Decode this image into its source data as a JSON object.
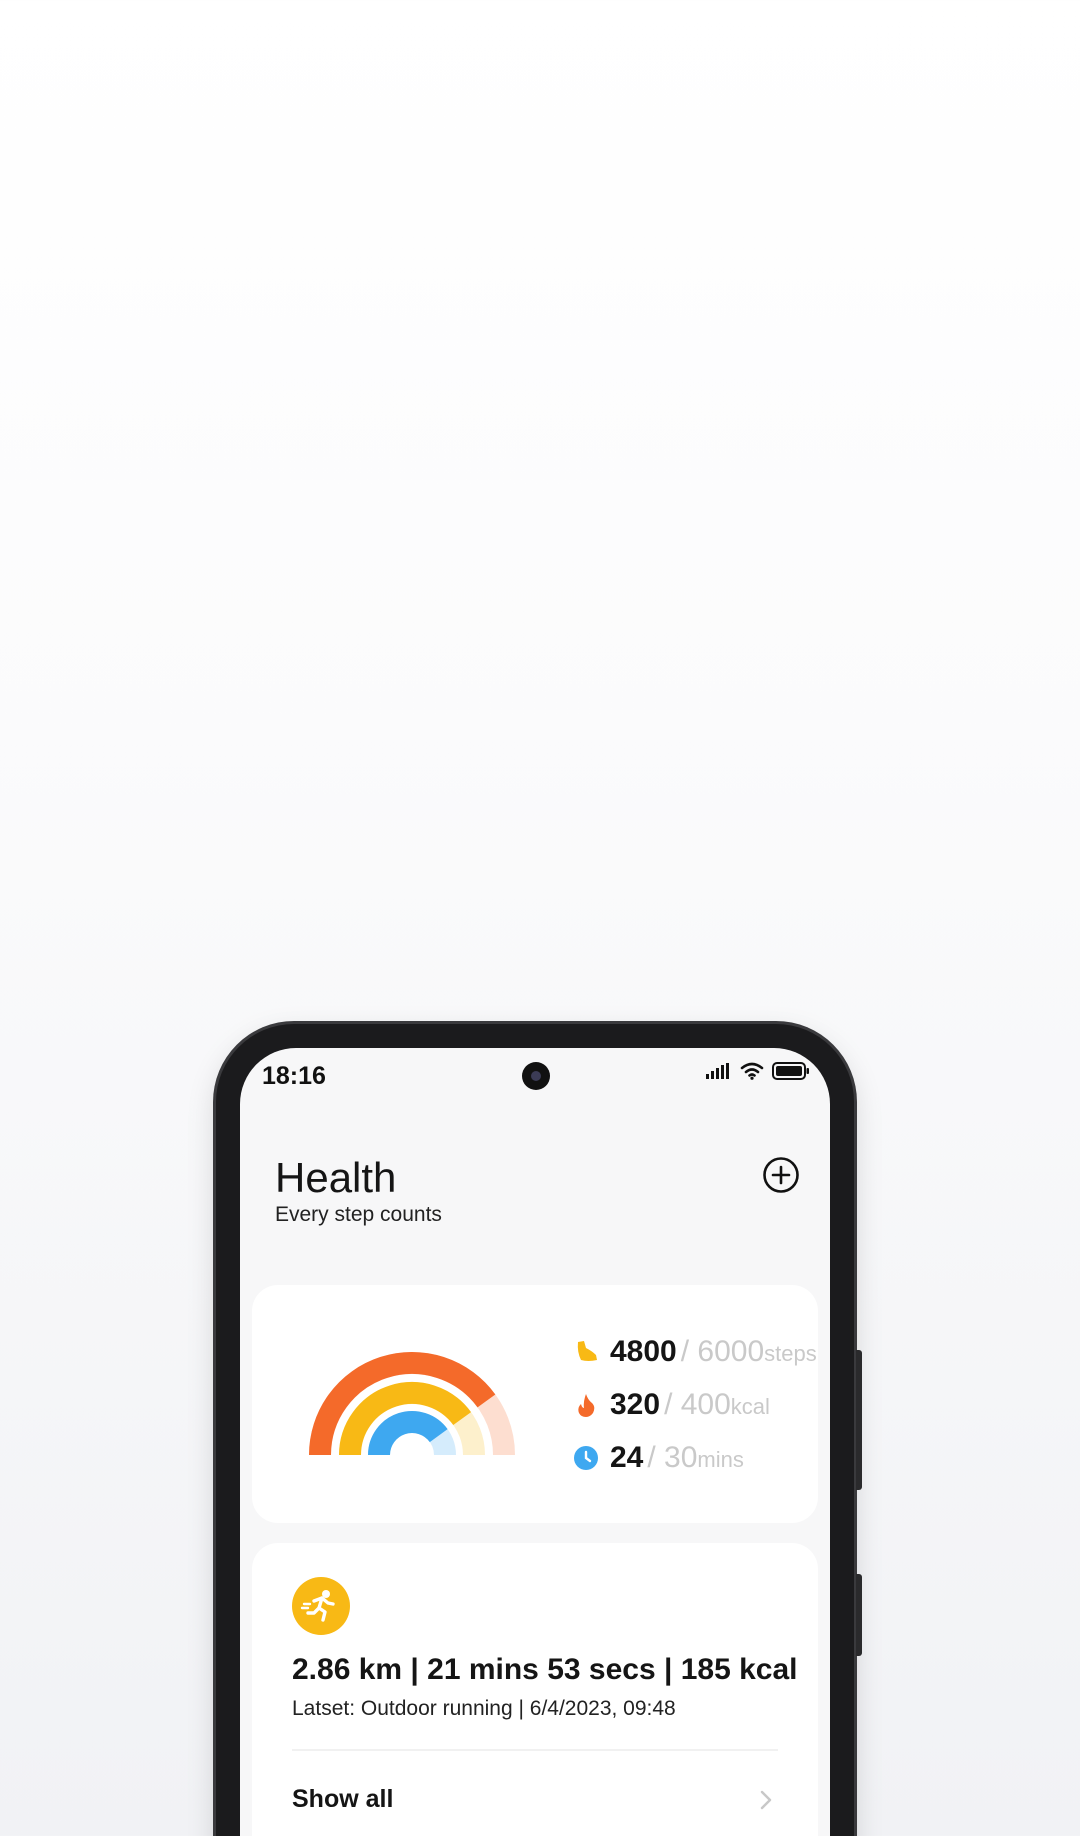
{
  "status_bar": {
    "time": "18:16",
    "icons": [
      "signal-icon",
      "wifi-icon",
      "battery-icon"
    ]
  },
  "header": {
    "title": "Health",
    "subtitle": "Every step counts",
    "add_icon": "plus-circle-icon"
  },
  "activity": {
    "metrics": [
      {
        "icon": "shoe-icon",
        "value": "4800",
        "goal": "/ 6000",
        "unit": "steps",
        "color": "#f8b915",
        "progress": 0.8
      },
      {
        "icon": "flame-icon",
        "value": "320",
        "goal": "/ 400",
        "unit": "kcal",
        "color": "#f46a2a",
        "progress": 0.8
      },
      {
        "icon": "clock-icon",
        "value": "24",
        "goal": "/ 30",
        "unit": "mins",
        "color": "#3ea8f0",
        "progress": 0.8
      }
    ]
  },
  "workout": {
    "icon": "running-icon",
    "summary": "2.86 km | 21 mins 53 secs | 185 kcal",
    "latest": "Latset:  Outdoor running | 6/4/2023, 09:48",
    "show_all": "Show all"
  },
  "colors": {
    "steps": "#f8b915",
    "calories": "#f46a2a",
    "minutes": "#3ea8f0",
    "background": "#f7f7f8"
  }
}
